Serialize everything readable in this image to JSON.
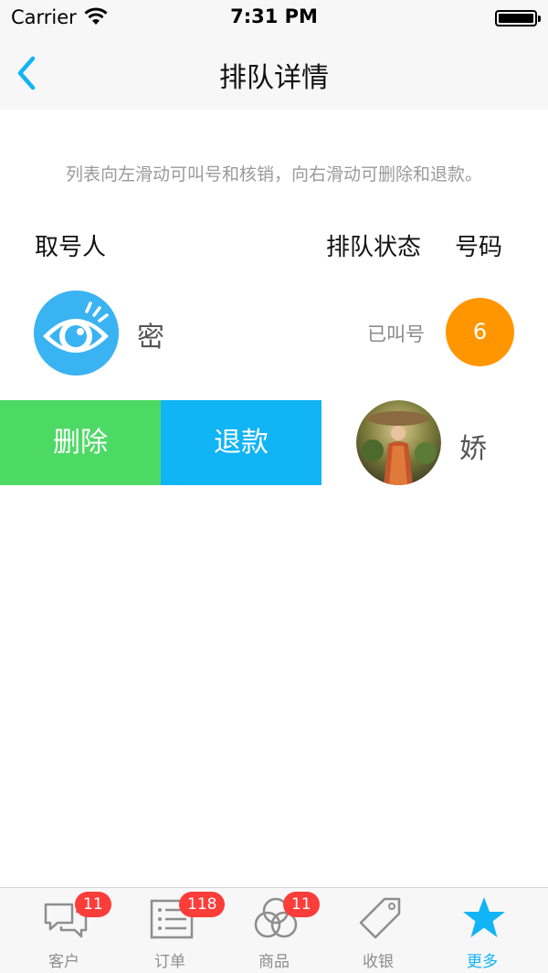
{
  "status_bar": {
    "carrier": "Carrier",
    "time": "7:31 PM"
  },
  "nav": {
    "title": "排队详情"
  },
  "hint": "列表向左滑动可叫号和核销，向右滑动可删除和退款。",
  "columns": {
    "taker": "取号人",
    "status": "排队状态",
    "number": "号码"
  },
  "rows": [
    {
      "name": "密",
      "status": "已叫号",
      "number": "6"
    },
    {
      "name": "娇",
      "actions": {
        "delete": "删除",
        "refund": "退款"
      }
    }
  ],
  "colors": {
    "accent": "#11b4f5",
    "delete": "#4cd964",
    "number_badge": "#ff9600",
    "badge": "#fc3d39"
  },
  "tabs": [
    {
      "label": "客户",
      "badge": "11",
      "icon": "chat-bubbles-icon"
    },
    {
      "label": "订单",
      "badge": "118",
      "icon": "list-icon"
    },
    {
      "label": "商品",
      "badge": "11",
      "icon": "circles-icon"
    },
    {
      "label": "收银",
      "icon": "price-tag-icon"
    },
    {
      "label": "更多",
      "icon": "star-icon",
      "active": true
    }
  ]
}
